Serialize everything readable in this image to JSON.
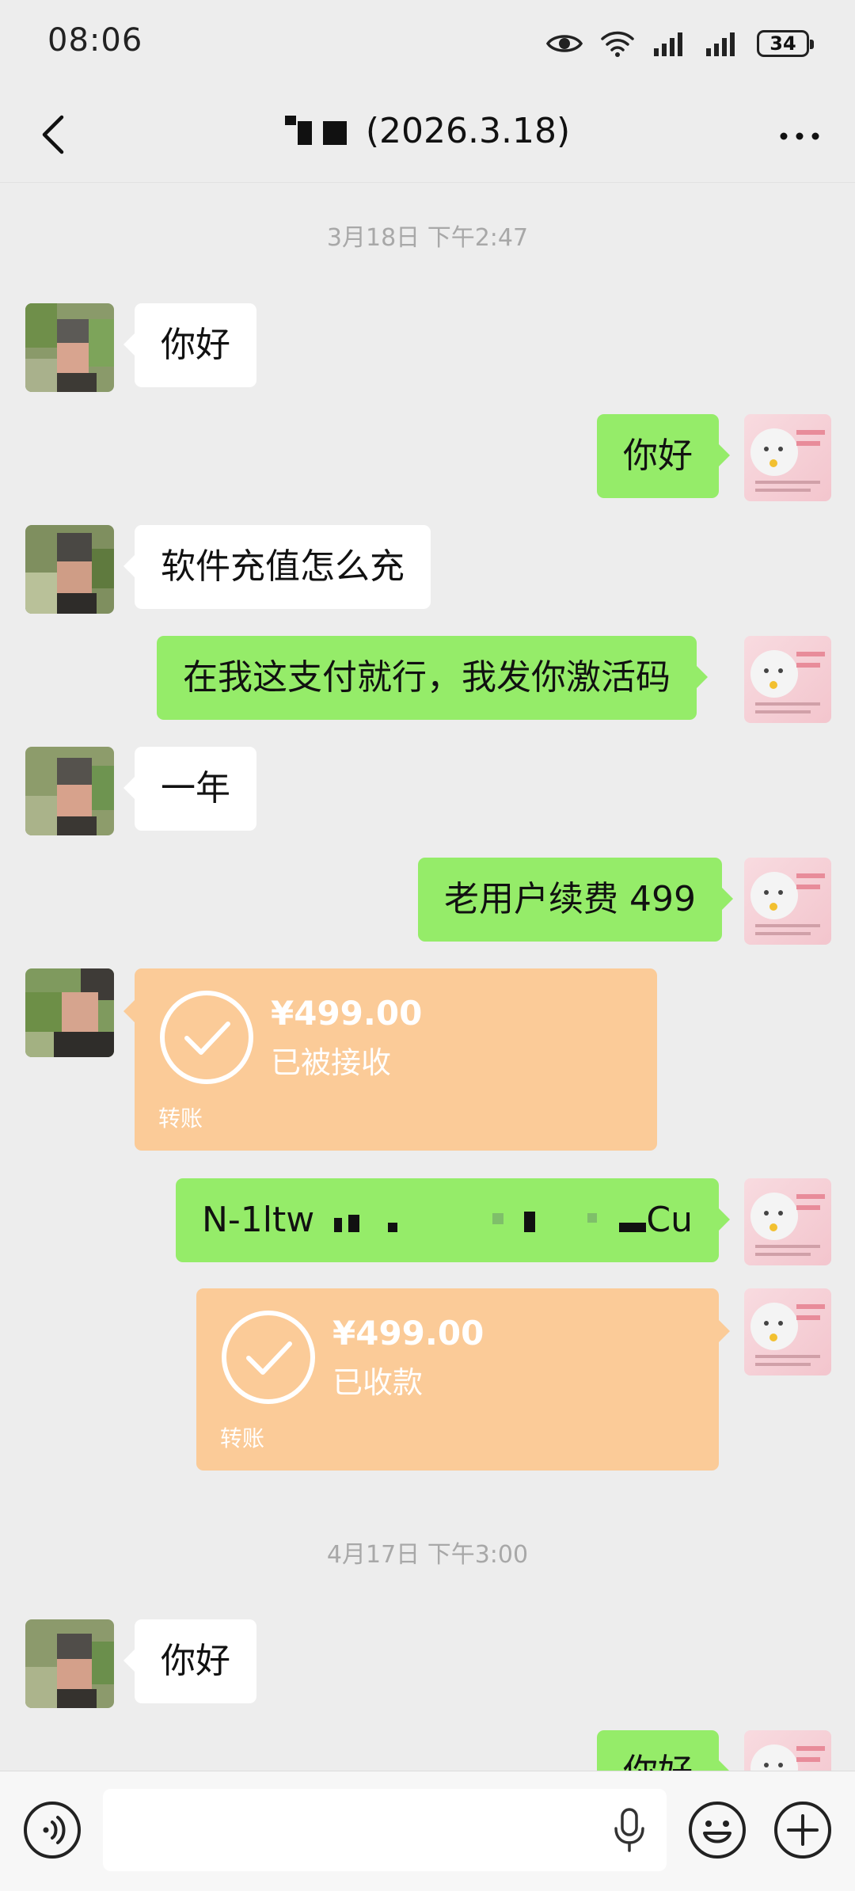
{
  "status_bar": {
    "time": "08:06",
    "battery": "34"
  },
  "header": {
    "title_suffix": "(2026.3.18)"
  },
  "messages": {
    "ts1": "3月18日 下午2:47",
    "m1": "你好",
    "m2": "你好",
    "m3": "软件充值怎么充",
    "m4": "在我这支付就行，我发你激活码",
    "m5": "一年",
    "m6": "老用户续费 499",
    "transfer1": {
      "amount": "¥499.00",
      "status": "已被接收",
      "label": "转账"
    },
    "m7_start": "N-1ltw",
    "m7_end": "Cu",
    "transfer2": {
      "amount": "¥499.00",
      "status": "已收款",
      "label": "转账"
    },
    "ts2": "4月17日 下午3:00",
    "m8": "你好",
    "m9": "你好"
  },
  "colors": {
    "background": "#ededed",
    "my_bubble": "#95ec69",
    "other_bubble": "#ffffff",
    "transfer": "#fbcb98"
  },
  "icons": {
    "status": [
      "eye-icon",
      "wifi-icon",
      "signal-icon",
      "signal-icon",
      "battery-icon"
    ],
    "header": [
      "back-arrow-icon",
      "more-icon"
    ],
    "input_bar": [
      "voice-icon",
      "mic-icon",
      "emoji-icon",
      "plus-icon"
    ]
  }
}
